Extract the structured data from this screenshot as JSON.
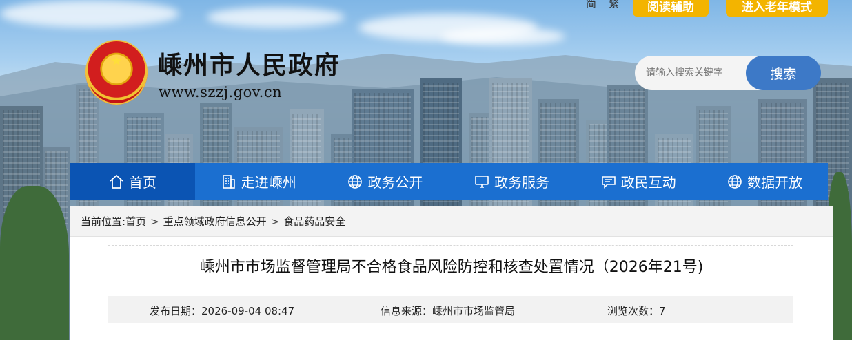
{
  "top_links": {
    "simplified": "简",
    "traditional": "繁",
    "reading_aid": "阅读辅助",
    "elder_mode": "进入老年模式"
  },
  "site": {
    "title": "嵊州市人民政府",
    "url": "www.szzj.gov.cn"
  },
  "search": {
    "placeholder": "请输入搜索关键字",
    "button": "搜索"
  },
  "nav": {
    "items": [
      {
        "label": "首页",
        "icon": "home-icon"
      },
      {
        "label": "走进嵊州",
        "icon": "building-icon"
      },
      {
        "label": "政务公开",
        "icon": "globe-icon"
      },
      {
        "label": "政务服务",
        "icon": "monitor-icon"
      },
      {
        "label": "政民互动",
        "icon": "chat-icon"
      },
      {
        "label": "数据开放",
        "icon": "globe-icon"
      }
    ],
    "active_index": 0
  },
  "breadcrumb": {
    "prefix": "当前位置:",
    "items": [
      "首页",
      "重点领域政府信息公开",
      "食品药品安全"
    ],
    "separator": ">"
  },
  "article": {
    "title": "嵊州市市场监督管理局不合格食品风险防控和核查处置情况（2026年21号)",
    "publish_date": "发布日期：2026-09-04 08:47",
    "source": "信息来源：嵊州市市场监管局",
    "views": "浏览次数：7"
  },
  "colors": {
    "nav_bg": "#1b6fd0",
    "nav_active": "#0b54b3",
    "pill_bg": "#f3b400",
    "search_btn": "#3d79c7"
  }
}
